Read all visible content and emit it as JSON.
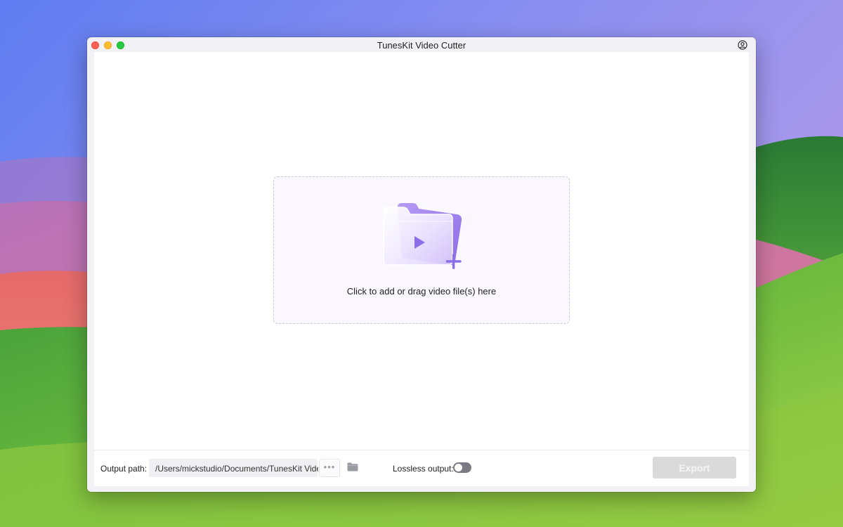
{
  "window": {
    "title": "TunesKit Video Cutter"
  },
  "dropzone": {
    "text": "Click to add or drag video file(s) here"
  },
  "bottom_bar": {
    "output_path_label": "Output path:",
    "output_path_value": "/Users/mickstudio/Documents/TunesKit Video",
    "more_button": "•••",
    "lossless_label": "Lossless output:",
    "lossless_enabled": false,
    "export_label": "Export"
  },
  "icons": {
    "account": "user-circle-icon",
    "browse_folder": "folder-icon",
    "add_video": "add-video-folder-icon"
  },
  "colors": {
    "accent_purple": "#8b6ee8",
    "export_disabled": "#dadada",
    "toggle_off": "#7b7a83"
  }
}
